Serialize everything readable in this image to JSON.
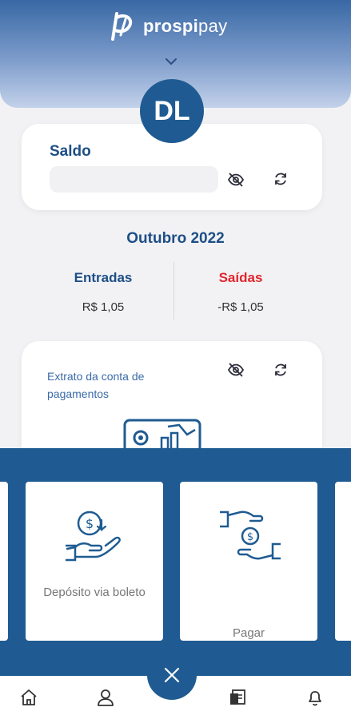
{
  "brand": {
    "name_bold": "prospi",
    "name_light": "pay"
  },
  "user": {
    "initials": "DL"
  },
  "balance": {
    "title": "Saldo"
  },
  "summary": {
    "month": "Outubro 2022",
    "income_label": "Entradas",
    "income_value": "R$ 1,05",
    "outcome_label": "Saídas",
    "outcome_value": "-R$ 1,05"
  },
  "statement": {
    "title": "Extrato da conta de pagamentos"
  },
  "actions": [
    {
      "label": "Depósito via boleto",
      "icon": "deposit-icon"
    },
    {
      "label": "Pagar",
      "icon": "pay-icon"
    }
  ],
  "nav": [
    "home-icon",
    "profile-icon",
    "statement-icon",
    "bell-icon"
  ],
  "colors": {
    "primary": "#1f5b92",
    "title": "#1e4f86",
    "income": "#1e4f86",
    "outcome": "#e0262f"
  }
}
